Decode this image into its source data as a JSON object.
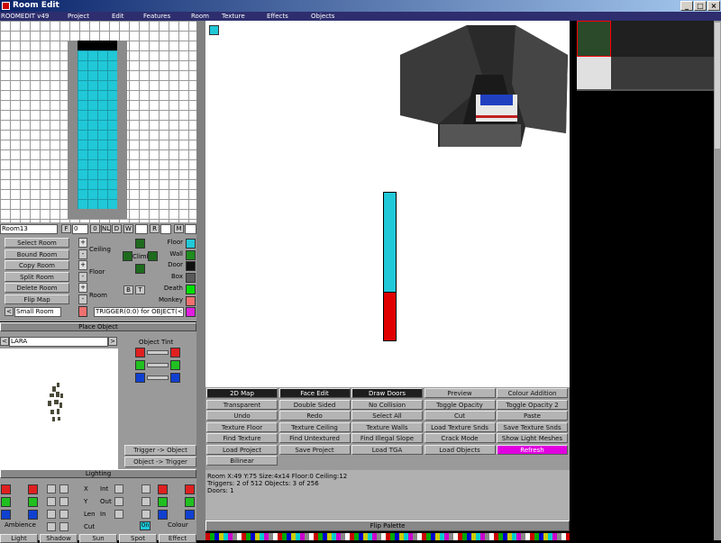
{
  "window": {
    "title": "Room Edit"
  },
  "menu": [
    "ROOMEDIT v49",
    "Project",
    "Edit",
    "Features",
    "Room",
    "Texture",
    "Effects",
    "Objects"
  ],
  "room_fields": {
    "name": "Room13",
    "f_label": "F",
    "f_value": "0",
    "btn_o": "0",
    "btn_nl": "NL",
    "btn_d": "D",
    "btn_w": "W",
    "btn_r": "R",
    "btn_m": "M"
  },
  "room_buttons": [
    "Select Room",
    "Bound Room",
    "Copy Room",
    "Split Room",
    "Delete Room",
    "Flip Map"
  ],
  "room_size": {
    "value": "Small Room",
    "arrow_left": "<"
  },
  "height_labels": {
    "ceiling": "Ceiling",
    "floor": "Floor",
    "room": "Room",
    "climb": "Climb",
    "b": "B",
    "t": "T"
  },
  "side_buttons": [
    "+",
    "-",
    "+",
    "-",
    "+",
    "-"
  ],
  "trigger_field": "TRIGGER(0:0) for OBJECT(<-",
  "legend": [
    {
      "label": "Floor",
      "color": "#20c8d8"
    },
    {
      "label": "Wall",
      "color": "#1e8c1e"
    },
    {
      "label": "Door",
      "color": "#101010"
    },
    {
      "label": "Box",
      "color": "#5a5a5a"
    },
    {
      "label": "Death",
      "color": "#00e000"
    },
    {
      "label": "Monkey",
      "color": "#f07070"
    },
    {
      "label": "Climb",
      "color": "#e020e0"
    }
  ],
  "place_object": {
    "header": "Place Object",
    "value": "LARA",
    "arrow_left": "<",
    "arrow_right": ">"
  },
  "object_tint": {
    "label": "Object Tint"
  },
  "trigger_buttons": [
    "Trigger -> Object",
    "Object -> Trigger"
  ],
  "lighting": {
    "header": "Lighting",
    "rows": [
      "X",
      "Y",
      "Len",
      "Cut"
    ],
    "right_rows": [
      "Int",
      "Out",
      "In"
    ],
    "ambience": "Ambience",
    "colour": "Colour",
    "on": "On"
  },
  "bottom_tabs": [
    "Light",
    "Shadow",
    "Sun",
    "Spot",
    "Effect"
  ],
  "toolbar": [
    {
      "label": "2D Map",
      "style": "dark"
    },
    {
      "label": "Face Edit",
      "style": "dark"
    },
    {
      "label": "Draw Doors",
      "style": "dark"
    },
    {
      "label": "Preview",
      "style": "normal"
    },
    {
      "label": "Colour Addition",
      "style": "normal"
    },
    {
      "label": "Transparent",
      "style": "normal"
    },
    {
      "label": "Double Sided",
      "style": "normal"
    },
    {
      "label": "No Collision",
      "style": "normal"
    },
    {
      "label": "Toggle Opacity",
      "style": "normal"
    },
    {
      "label": "Toggle Opacity 2",
      "style": "normal"
    },
    {
      "label": "Undo",
      "style": "normal"
    },
    {
      "label": "Redo",
      "style": "normal"
    },
    {
      "label": "Select All",
      "style": "normal"
    },
    {
      "label": "Cut",
      "style": "normal"
    },
    {
      "label": "Paste",
      "style": "normal"
    },
    {
      "label": "Texture Floor",
      "style": "normal"
    },
    {
      "label": "Texture Ceiling",
      "style": "normal"
    },
    {
      "label": "Texture Walls",
      "style": "normal"
    },
    {
      "label": "Load Texture Snds",
      "style": "normal"
    },
    {
      "label": "Save Texture Snds",
      "style": "normal"
    },
    {
      "label": "Find Texture",
      "style": "normal"
    },
    {
      "label": "Find Untextured",
      "style": "normal"
    },
    {
      "label": "Find Illegal Slope",
      "style": "normal"
    },
    {
      "label": "Crack Mode",
      "style": "normal"
    },
    {
      "label": "Show Light Meshes",
      "style": "normal"
    },
    {
      "label": "Load Project",
      "style": "normal"
    },
    {
      "label": "Save Project",
      "style": "normal"
    },
    {
      "label": "Load TGA",
      "style": "normal"
    },
    {
      "label": "Load Objects",
      "style": "normal"
    },
    {
      "label": "Refresh",
      "style": "pink"
    },
    {
      "label": "Bilinear",
      "style": "normal"
    }
  ],
  "status": [
    "Room X:49  Y:75      Size:4x14      Floor:0  Ceiling:12",
    "Triggers: 2 of 512   Objects: 3 of 256",
    "Doors: 1"
  ],
  "flip_palette": "Flip Palette"
}
